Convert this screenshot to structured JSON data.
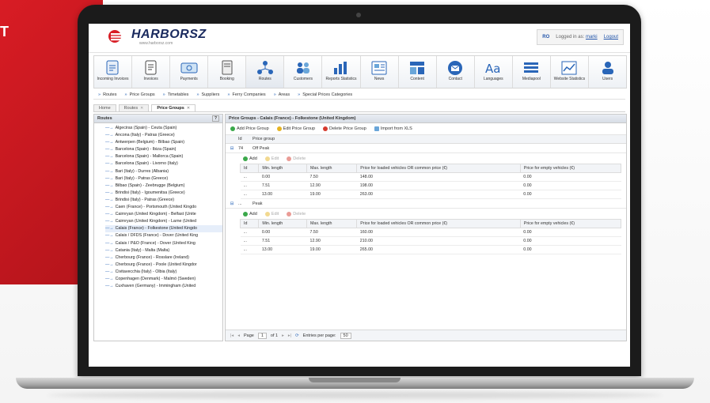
{
  "backdrop_text": "T",
  "app": {
    "logo": "HARBORSZ",
    "logo_sub": "www.harborsz.com",
    "lang": "RO",
    "login_prefix": "Logged in as:",
    "login_user": "marki",
    "logout": "Logout"
  },
  "toolbar": [
    {
      "label": "Incoming Invoices",
      "icon": "incoming-invoices-icon"
    },
    {
      "label": "Invoices",
      "icon": "invoices-icon"
    },
    {
      "label": "Payments",
      "icon": "payments-icon"
    },
    {
      "label": "Booking",
      "icon": "booking-icon"
    },
    {
      "label": "Routes",
      "icon": "routes-icon"
    },
    {
      "label": "Customers",
      "icon": "customers-icon"
    },
    {
      "label": "Reports Statistics",
      "icon": "reports-icon"
    },
    {
      "label": "News",
      "icon": "news-icon"
    },
    {
      "label": "Content",
      "icon": "content-icon"
    },
    {
      "label": "Contact",
      "icon": "contact-icon"
    },
    {
      "label": "Languages",
      "icon": "languages-icon"
    },
    {
      "label": "Mediapool",
      "icon": "mediapool-icon"
    },
    {
      "label": "Website Statistics",
      "icon": "website-statistics-icon"
    },
    {
      "label": "Users",
      "icon": "users-icon"
    }
  ],
  "submenu": [
    "Routes",
    "Price Groups",
    "Timetables",
    "Suppliers",
    "Ferry Companies",
    "Areas",
    "Special Prices Categories"
  ],
  "tabs": [
    {
      "label": "Home",
      "active": false
    },
    {
      "label": "Routes",
      "active": false
    },
    {
      "label": "Price Groups",
      "active": true
    }
  ],
  "left_panel": {
    "title": "Routes",
    "routes": [
      "Algeciras (Spain) - Ceuta (Spain)",
      "Ancona (Italy) - Patras (Greece)",
      "Antwerpen (Belgium) - Bilbao (Spain)",
      "Barcelona (Spain) - Ibiza (Spain)",
      "Barcelona (Spain) - Mallorca (Spain)",
      "Barcelona (Spain) - Livorno (Italy)",
      "Bari (Italy) - Durres (Albania)",
      "Bari (Italy) - Patras (Greece)",
      "Bilbao (Spain) - Zeebrugge (Belgium)",
      "Brindisi (Italy) - Igoumenitsa (Greece)",
      "Brindisi (Italy) - Patras (Greece)",
      "Caen (France) - Portsmouth (United Kingdo",
      "Cairnryan (United Kingdom) - Belfast (Unite",
      "Cairnryan (United Kingdom) - Larne (United",
      "Calais (France) - Folkestone (United Kingdo",
      "Calais / DFDS (France) - Dover (United King",
      "Calais / P&O (France) - Dover (United King",
      "Catania (Italy) - Malta (Malta)",
      "Cherbourg (France) - Rosslare (Ireland)",
      "Cherbourg (France) - Poole (United Kingdor",
      "Civitavecchia (Italy) - Olbia (Italy)",
      "Copenhagen (Denmark) - Malmö (Sweden)",
      "Cuxhaven (Germany) - Immingham (United"
    ],
    "selected_index": 14
  },
  "right_panel": {
    "title": "Price Groups - Calais (France) - Folkestone (United Kingdom)",
    "actions": [
      "Add Price Group",
      "Edit Price Group",
      "Delete Price Group",
      "Import from XLS"
    ],
    "col_id": "Id",
    "col_group": "Price group",
    "sub_actions": [
      "Add",
      "Edit",
      "Delete"
    ],
    "columns": [
      "Id",
      "Min. length",
      "Max. length",
      "Price for loaded vehicles OR common price (€)",
      "Price for empty vehicles (€)"
    ],
    "groups": [
      {
        "id": "74",
        "name": "Off Peak",
        "rows": [
          {
            "id": "...",
            "min": "0.00",
            "max": "7.50",
            "loaded": "148.00",
            "empty": "0.00"
          },
          {
            "id": "...",
            "min": "7.51",
            "max": "12.90",
            "loaded": "198.00",
            "empty": "0.00"
          },
          {
            "id": "...",
            "min": "13.00",
            "max": "19.00",
            "loaded": "263.00",
            "empty": "0.00"
          }
        ]
      },
      {
        "id": "...",
        "name": "Peak",
        "rows": [
          {
            "id": "...",
            "min": "0.00",
            "max": "7.50",
            "loaded": "160.00",
            "empty": "0.00"
          },
          {
            "id": "...",
            "min": "7.51",
            "max": "12.90",
            "loaded": "210.00",
            "empty": "0.00"
          },
          {
            "id": "...",
            "min": "13.00",
            "max": "19.00",
            "loaded": "265.00",
            "empty": "0.00"
          }
        ]
      }
    ],
    "pager": {
      "page_label": "Page",
      "page": "1",
      "of": "of 1",
      "entries_label": "Entries per page:",
      "entries": "50"
    }
  }
}
